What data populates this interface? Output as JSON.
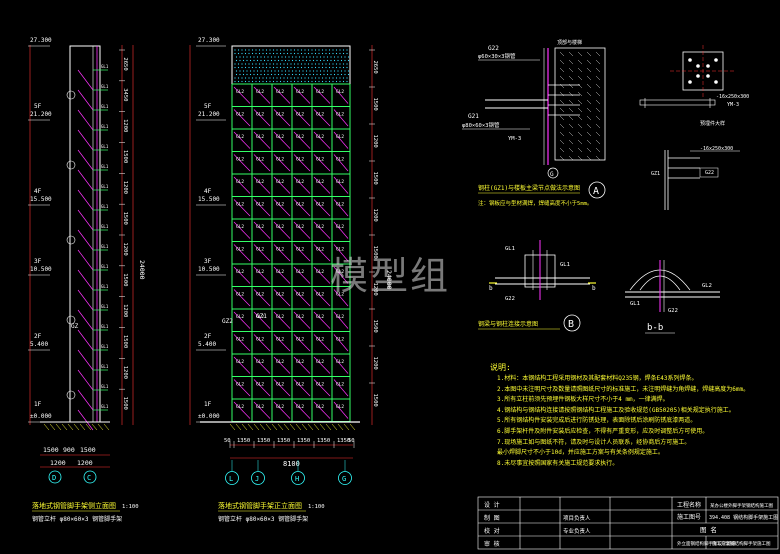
{
  "elevations": {
    "top": "27.300",
    "f5": "21.200",
    "f4": "15.500",
    "f3": "10.500",
    "f2": "5.400",
    "f1": "±0.000"
  },
  "floor_marks": [
    "5F",
    "4F",
    "3F",
    "2F",
    "1F"
  ],
  "left_view": {
    "dims_right": [
      "2650",
      "3450",
      "1200",
      "1500",
      "1200",
      "1500",
      "1200",
      "1500",
      "1200",
      "1500",
      "1200",
      "1500"
    ],
    "total_height": "24000",
    "bottom_dims_1": [
      "1500",
      "900",
      "1500"
    ],
    "bottom_dims_2": [
      "1200",
      "1200"
    ],
    "column_label": "GZ",
    "title": "落地式钢管脚手架侧立面图",
    "scale": "1:100",
    "note": "钢管立杆  φ80×60×3  钢管脚手架",
    "axes": [
      "D",
      "C"
    ]
  },
  "front_view": {
    "bottom_dims": [
      "50",
      "1350",
      "1350",
      "1350",
      "1350",
      "1350",
      "1350",
      "50"
    ],
    "total_width": "8100",
    "right_dims": [
      "2650",
      "1500",
      "1200",
      "1500",
      "1200",
      "1500",
      "1200",
      "1500",
      "1200",
      "1500"
    ],
    "total_height": "24000",
    "member_label": "GL2",
    "column_labels": [
      "GZ2",
      "GZ1"
    ],
    "title": "落地式钢管脚手架正立面图",
    "scale": "1:100",
    "note": "钢管立杆  φ80×60×3  钢管脚手架",
    "axes": [
      "L",
      "J",
      "H",
      "G"
    ]
  },
  "detail_a": {
    "labels": [
      "G22",
      "G21",
      "YM-3"
    ],
    "sections": [
      "φ60×30×3钢管",
      "φ80×60×3钢管"
    ],
    "top_note": "顶部与楼梯",
    "title": "钢柱(GZ1)与楼板主梁节点做法示意图",
    "marker": "A",
    "note": "注：钢板应与型材满焊，焊缝高度不小于5mm。"
  },
  "detail_plate": {
    "labels": [
      "-16x250x300",
      "YM-3",
      "GZ1",
      "G22"
    ],
    "title": "预埋件大样"
  },
  "detail_b": {
    "labels": [
      "GL1",
      "b",
      "b",
      "G22",
      "GL1"
    ],
    "title": "钢梁与钢柱连接示意图",
    "marker": "B"
  },
  "section_bb": {
    "labels": [
      "GL1",
      "GL2",
      "G22"
    ],
    "title": "b-b"
  },
  "notes_title": "说明:",
  "notes": [
    "1.材料：本钢结构工程采用钢材及其配套材料Q235钢，焊条E43系列焊条。",
    "2.本图中未注明尺寸及数量请照图纸尺寸的标准施工，未注明焊缝为角焊缝，焊缝高度为6mm。",
    "3.所有立柱前须先预埋件钢板大样尺寸不小于4 mm，一律满焊。",
    "4.钢结构与钢结构连接请按照钢结构工程施工及验收规范(GB50205)相关规定执行施工。",
    "5.所有钢结构件安装完成后进行防锈处理，表面除锈后涂刷防锈底漆两道。",
    "6.脚手架杆件及附件安装后应检查，不得有严重变形，应及时调整后方可使用。",
    "7.现场施工如与图纸不符，请及时与设计人员联系，经协商后方可施工。",
    "  最小焊脚尺寸不小于10d，并应施工方案与有关条例规定施工。",
    "8.未尽事宜按照国家有关施工规范要求执行。"
  ],
  "title_block": {
    "project_label": "工程名称",
    "project_name": "某办公楼外脚手架钢结构施工图",
    "drawing_label": "施工图号",
    "drawing_number": "394.408 钢结构脚手架施工图",
    "rows": [
      "设 计",
      "制 图",
      "校 对",
      "审 核"
    ],
    "rows_mid": [
      "",
      "项目负责人",
      "专业负责人",
      ""
    ],
    "name_label": "图  名",
    "name_row": "外立面钢结构脚手架设计图纸",
    "bottom_note": "施工方案钢结构脚手架施工图"
  },
  "watermark": "模型组",
  "colors": {
    "frame": "#ffffff",
    "steel": "#ff33ff",
    "members": "#33ff66",
    "dims": "#ff3333",
    "text": "#ffff33",
    "axis": "#33ffff",
    "hatch": "#33ddff"
  }
}
